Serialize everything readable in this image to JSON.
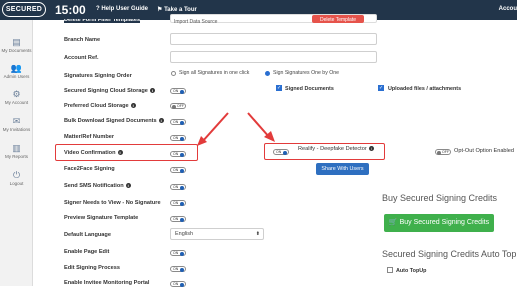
{
  "topbar": {
    "logo": "SECURED",
    "clock": "15:00",
    "help": "Help User Guide",
    "tour": "Take a Tour",
    "account": "Accou"
  },
  "sidebar": [
    {
      "icon": "documents-icon",
      "glyph": "▤",
      "label": "My Documents"
    },
    {
      "icon": "admin-users-icon",
      "glyph": "👥",
      "label": "Admin Users"
    },
    {
      "icon": "account-icon",
      "glyph": "⚙",
      "label": "My Account"
    },
    {
      "icon": "invitations-icon",
      "glyph": "✉",
      "label": "My Invitations"
    },
    {
      "icon": "reports-icon",
      "glyph": "▥",
      "label": "My Reports"
    },
    {
      "icon": "logout-icon",
      "glyph": "⏻",
      "label": "Logout"
    }
  ],
  "form": {
    "top_cut_label": "Delete Form Filler Templates",
    "top_cut_value": "Import Data Source",
    "top_cut_button": "Delete Template",
    "branch_name": "Branch Name",
    "account_ref": "Account Ref.",
    "signatures_order": "Signatures Signing Order",
    "order_opt1": "Sign all Signatures in one click",
    "order_opt2": "Sign Signatures One by One",
    "secured_cloud": "Secured Signing Cloud Storage",
    "signed_documents": "Signed Documents",
    "uploaded_files": "Uploaded files / attachments",
    "preferred_cloud": "Preferred Cloud Storage",
    "bulk_download": "Bulk Download Signed Documents",
    "matter_ref": "Matter/Ref Number",
    "video_confirmation": "Video Confirmation",
    "realify": "Realify - Deepfake Detector",
    "opt_out": "Opt-Out Option Enabled",
    "face2face": "Face2Face Signing",
    "share_users": "Share With Users",
    "send_sms": "Send SMS Notification",
    "signer_needs_view": "Signer Needs to View - No Signature",
    "preview_template": "Preview Signature Template",
    "default_language": "Default Language",
    "language_value": "English",
    "enable_page_edit": "Enable Page Edit",
    "edit_signing_process": "Edit Signing Process",
    "invitee_portal": "Enable Invitee Monitoring Portal"
  },
  "toggles": {
    "on": "ON",
    "off": "OFF"
  },
  "credits": {
    "buy_heading": "Buy Secured Signing Credits",
    "buy_button": "Buy Secured Signing Credits",
    "auto_heading": "Secured Signing Credits Auto TopUp",
    "auto_label": "Auto TopUp"
  },
  "colors": {
    "topbar": "#22354a",
    "highlight": "#e23b3b",
    "green": "#3fb04c",
    "blue": "#2e6fc0"
  }
}
